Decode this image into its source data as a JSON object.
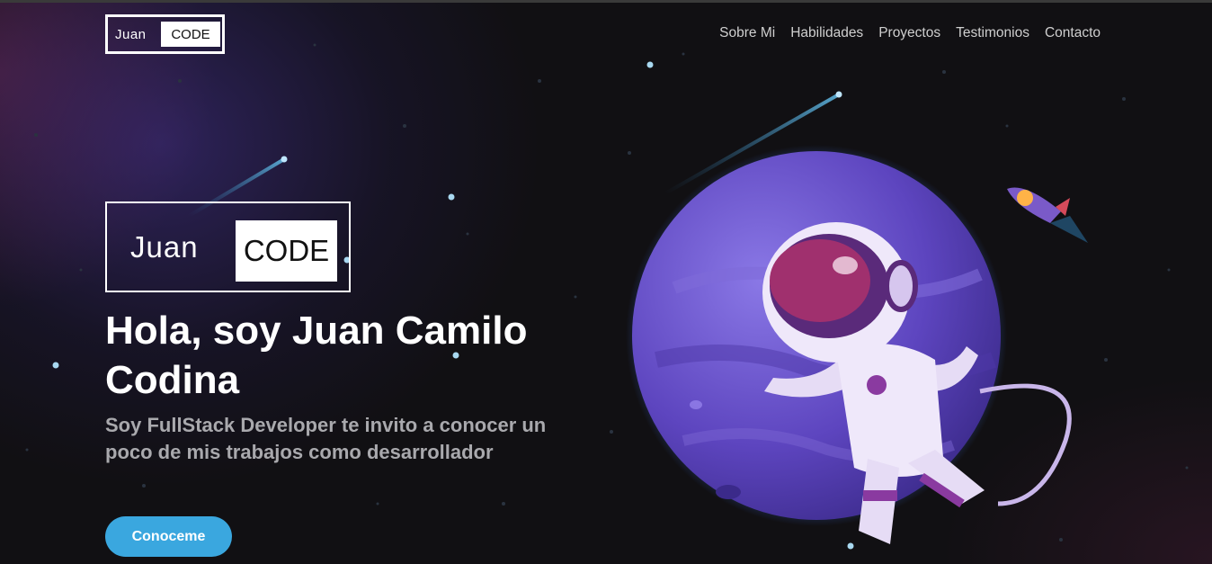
{
  "header": {
    "logo": {
      "first": "Juan",
      "second": "CODE"
    },
    "nav": [
      "Sobre Mi",
      "Habilidades",
      "Proyectos",
      "Testimonios",
      "Contacto"
    ]
  },
  "hero": {
    "logo": {
      "first": "Juan",
      "second": "CODE"
    },
    "title": "Hola, soy Juan Camilo Codina",
    "subtitle": "Soy FullStack Developer te invito a conocer un poco de mis trabajos como desarrollador",
    "cta_label": "Conoceme"
  },
  "colors": {
    "accent": "#3aa7df",
    "background": "#111013",
    "planet": "#6a52c8",
    "subtitle": "#a9a9ad"
  },
  "icons": [
    "astronaut-illustration",
    "planet-illustration",
    "rocket-icon",
    "shooting-star"
  ]
}
